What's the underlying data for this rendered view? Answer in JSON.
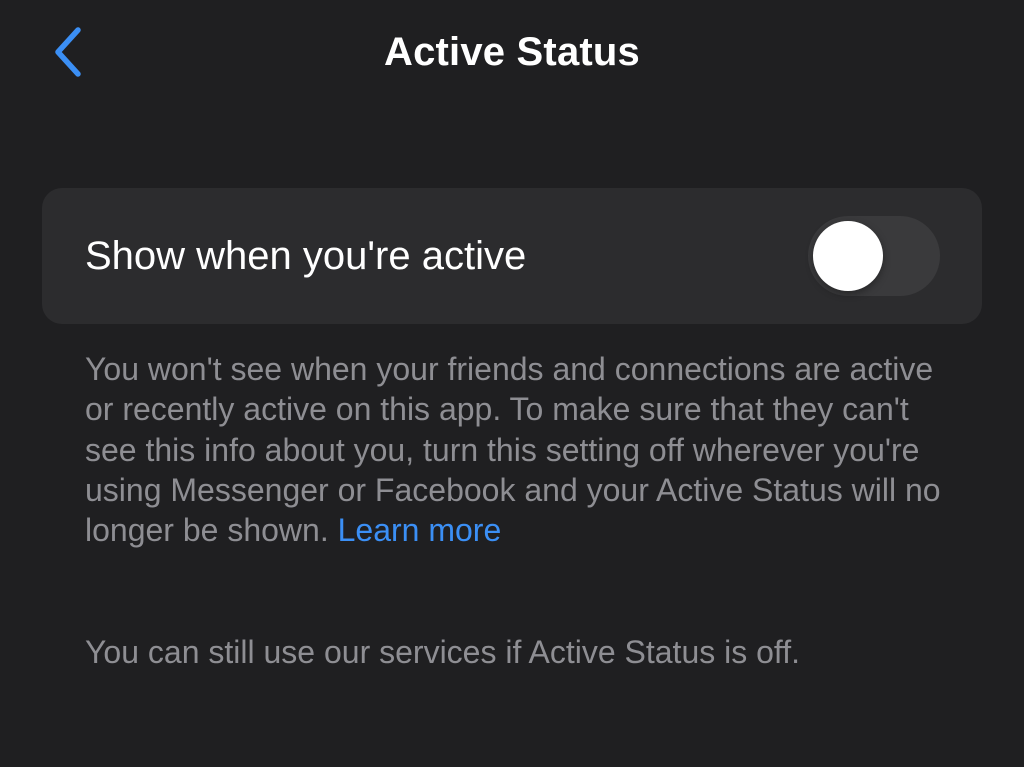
{
  "header": {
    "back_icon": "chevron-left-icon",
    "title": "Active Status"
  },
  "setting": {
    "label": "Show when you're active",
    "toggle_on": false
  },
  "description": {
    "text": "You won't see when your friends and connections are active or recently active on this app. To make sure that they can't see this info about you, turn this setting off wherever you're using Messenger or Facebook and your Active Status will no longer be shown.",
    "link_label": "Learn more"
  },
  "note": "You can still use our services if Active Status is off.",
  "colors": {
    "background": "#1f1f21",
    "card": "#2c2c2e",
    "accent": "#3b8ff5",
    "secondary_text": "#8e8e93",
    "toggle_track_off": "#3a3a3c"
  }
}
